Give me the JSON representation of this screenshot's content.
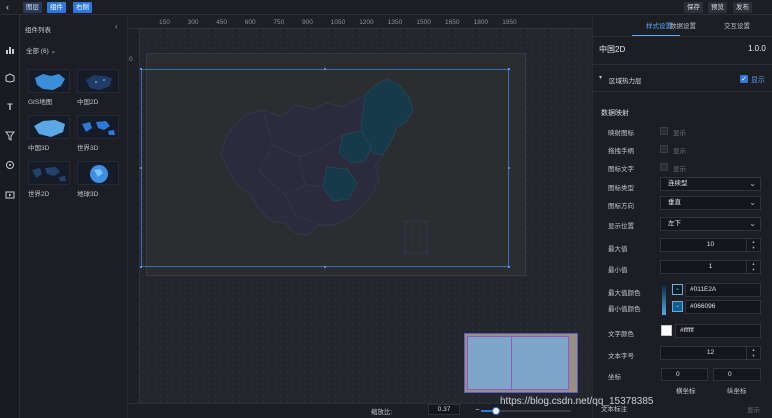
{
  "toolbar": {
    "back_icon": "chevron-left-icon",
    "layers": "图层",
    "components": "组件",
    "right_side": "右侧",
    "save": "保存",
    "preview": "预览",
    "publish": "发布",
    "active_color": "#2d78d8"
  },
  "icon_strip": [
    "chart-icon",
    "map-cube-icon",
    "text-icon",
    "filter-icon",
    "media-icon",
    "video-icon"
  ],
  "component_panel": {
    "title": "组件列表",
    "collapse_icon": "chevron-left-icon",
    "filter": "全部 (6)",
    "items": [
      {
        "label": "GIS地图"
      },
      {
        "label": "中国2D"
      },
      {
        "label": "中国3D"
      },
      {
        "label": "世界3D"
      },
      {
        "label": "世界2D"
      },
      {
        "label": "地球3D"
      }
    ]
  },
  "ruler": {
    "ticks": [
      "150",
      "300",
      "450",
      "600",
      "750",
      "900",
      "1050",
      "1200",
      "1350",
      "1500",
      "1650",
      "1800",
      "1950"
    ],
    "vertical_zero": "0"
  },
  "zoom": {
    "label": "缩放比:",
    "value": "0.37",
    "minus": "−",
    "plus": "+"
  },
  "right_panel": {
    "tabs": [
      "样式设置",
      "数据设置",
      "交互设置"
    ],
    "active_tab": 0,
    "component_name": "中国2D",
    "version": "1.0.0",
    "section": {
      "title": "区域热力层",
      "show_label": "显示",
      "show_checked": true
    },
    "mapping_title": "数据映射",
    "rows": {
      "legend_icon": {
        "label": "映射图标",
        "value": "显示"
      },
      "drag_handle": {
        "label": "拖拽手柄",
        "value": "显示"
      },
      "legend_text": {
        "label": "图标文字",
        "value": "显示"
      },
      "legend_type": {
        "label": "图标类型",
        "value": "连续型"
      },
      "legend_dir": {
        "label": "图标方向",
        "value": "垂直"
      },
      "position": {
        "label": "显示位置",
        "value": "左下"
      },
      "max": {
        "label": "最大值",
        "value": "10"
      },
      "min": {
        "label": "最小值",
        "value": "1"
      },
      "max_color": {
        "label": "最大值颜色",
        "value": "#011E2A"
      },
      "min_color": {
        "label": "最小值颜色",
        "value": "#066096"
      },
      "text_color": {
        "label": "文字颜色",
        "value": "#ffffff"
      },
      "font_size": {
        "label": "文本字号",
        "value": "12"
      },
      "coord": {
        "label": "坐标",
        "x": "0",
        "y": "0",
        "x_label": "横坐标",
        "y_label": "纵坐标"
      },
      "text_note": {
        "label": "文本标注",
        "value": "显示"
      }
    }
  },
  "watermark": "https://blog.csdn.net/qq_15378385"
}
